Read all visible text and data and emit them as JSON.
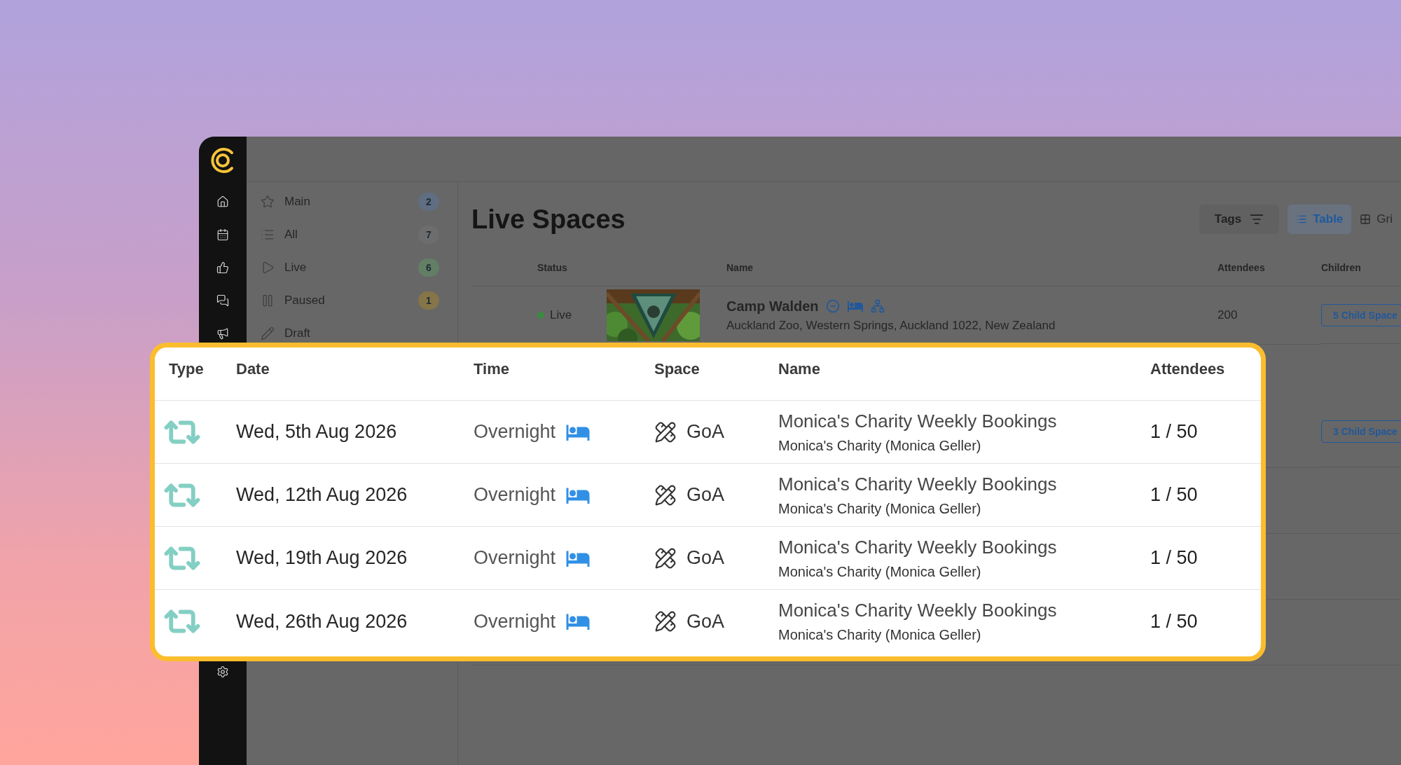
{
  "sidebar": {
    "items": [
      {
        "label": "Main",
        "count": "2",
        "color": "#5f6e80"
      },
      {
        "label": "All",
        "count": "7",
        "color": "#6d6d6d"
      },
      {
        "label": "Live",
        "count": "6",
        "color": "#627f65"
      },
      {
        "label": "Paused",
        "count": "1",
        "color": "#857548"
      },
      {
        "label": "Draft"
      }
    ]
  },
  "page": {
    "title": "Live Spaces",
    "tags_button": "Tags",
    "views": [
      {
        "label": "Table",
        "selected": true
      },
      {
        "label": "Gri",
        "selected": false
      }
    ]
  },
  "spaces_table": {
    "columns": [
      "Status",
      "Name",
      "Attendees",
      "Children"
    ],
    "rows": [
      {
        "status": "Live",
        "name": "Camp Walden",
        "address": "Auckland Zoo, Western Springs, Auckland 1022, New Zealand",
        "attendees": "200",
        "children": "5 Child Space"
      },
      {
        "children": "3 Child Space"
      }
    ]
  },
  "bookings": {
    "columns": [
      "Type",
      "Date",
      "Time",
      "Space",
      "Name",
      "Attendees"
    ],
    "rows": [
      {
        "date": "Wed, 5th Aug 2026",
        "time": "Overnight",
        "space": "GoA",
        "name": "Monica's Charity Weekly Bookings",
        "organiser": "Monica's Charity (Monica Geller)",
        "attendees": "1 / 50"
      },
      {
        "date": "Wed, 12th Aug 2026",
        "time": "Overnight",
        "space": "GoA",
        "name": "Monica's Charity Weekly Bookings",
        "organiser": "Monica's Charity (Monica Geller)",
        "attendees": "1 / 50"
      },
      {
        "date": "Wed, 19th Aug 2026",
        "time": "Overnight",
        "space": "GoA",
        "name": "Monica's Charity Weekly Bookings",
        "organiser": "Monica's Charity (Monica Geller)",
        "attendees": "1 / 50"
      },
      {
        "date": "Wed, 26th Aug 2026",
        "time": "Overnight",
        "space": "GoA",
        "name": "Monica's Charity Weekly Bookings",
        "organiser": "Monica's Charity (Monica Geller)",
        "attendees": "1 / 50"
      }
    ]
  }
}
